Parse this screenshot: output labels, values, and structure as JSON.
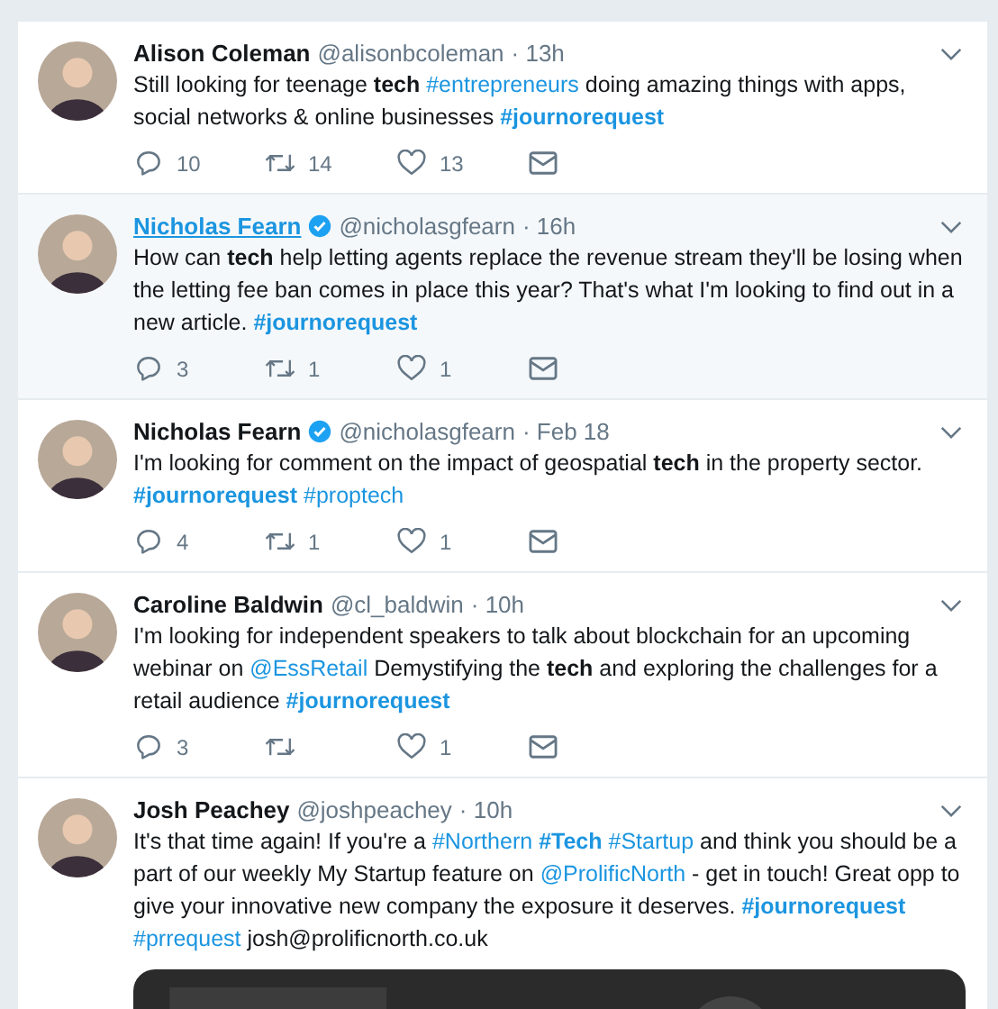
{
  "tweets": [
    {
      "name": "Alison Coleman",
      "verified": false,
      "highlighted": false,
      "handle": "@alisonbcoleman",
      "time": "· 13h",
      "text": [
        {
          "kind": "text",
          "text": "Still looking for teenage **tech** "
        },
        {
          "kind": "link",
          "text": "#entrepreneurs"
        },
        {
          "kind": "text",
          "text": " doing amazing things with apps, social networks & online businesses "
        },
        {
          "kind": "link",
          "text": "**#journorequest**"
        }
      ],
      "replies": "10",
      "retweets": "14",
      "likes": "13"
    },
    {
      "name": "Nicholas Fearn",
      "verified": true,
      "highlighted": true,
      "handle": "@nicholasgfearn",
      "time": "· 16h",
      "text": [
        {
          "kind": "text",
          "text": "How can **tech** help letting agents replace the revenue stream they'll be losing when the letting fee ban comes in place this year? That's what I'm looking to find out in a new article.  "
        },
        {
          "kind": "link",
          "text": "**#journorequest**"
        }
      ],
      "replies": "3",
      "retweets": "1",
      "likes": "1"
    },
    {
      "name": "Nicholas Fearn",
      "verified": true,
      "highlighted": false,
      "handle": "@nicholasgfearn",
      "time": "· Feb 18",
      "text": [
        {
          "kind": "text",
          "text": "I'm looking for comment on the impact of geospatial **tech** in the property sector. "
        },
        {
          "kind": "link",
          "text": "**#journorequest**"
        },
        {
          "kind": "space"
        },
        {
          "kind": "link",
          "text": "#proptech"
        }
      ],
      "replies": "4",
      "retweets": "1",
      "likes": "1"
    },
    {
      "name": "Caroline Baldwin",
      "verified": false,
      "highlighted": false,
      "handle": "@cl_baldwin",
      "time": "· 10h",
      "text": [
        {
          "kind": "text",
          "text": "I'm looking for independent speakers to talk about blockchain for an upcoming webinar on "
        },
        {
          "kind": "link",
          "text": "@EssRetail"
        },
        {
          "kind": "text",
          "text": "  Demystifying the **tech** and exploring the challenges for a retail audience "
        },
        {
          "kind": "link",
          "text": "**#journorequest**"
        }
      ],
      "replies": "3",
      "likes": "1"
    },
    {
      "name": "Josh Peachey",
      "verified": false,
      "highlighted": false,
      "handle": "@joshpeachey",
      "time": "· 10h",
      "text": [
        {
          "kind": "text",
          "text": "It's that time again! If you're a "
        },
        {
          "kind": "link",
          "text": "#Northern"
        },
        {
          "kind": "space"
        },
        {
          "kind": "link",
          "text": "**#Tech**"
        },
        {
          "kind": "space"
        },
        {
          "kind": "link",
          "text": "#Startup"
        },
        {
          "kind": "text",
          "text": " and think you should be a part of our weekly My Startup feature on "
        },
        {
          "kind": "link",
          "text": "@ProlificNorth"
        },
        {
          "kind": "text",
          "text": " - get in touch! Great opp to give your innovative new company the exposure it deserves. "
        },
        {
          "kind": "link",
          "text": "**#journorequest**"
        },
        {
          "kind": "space"
        },
        {
          "kind": "link",
          "text": "#prrequest"
        },
        {
          "kind": "text",
          "text": " josh@prolificnorth.co.uk"
        }
      ]
    }
  ]
}
